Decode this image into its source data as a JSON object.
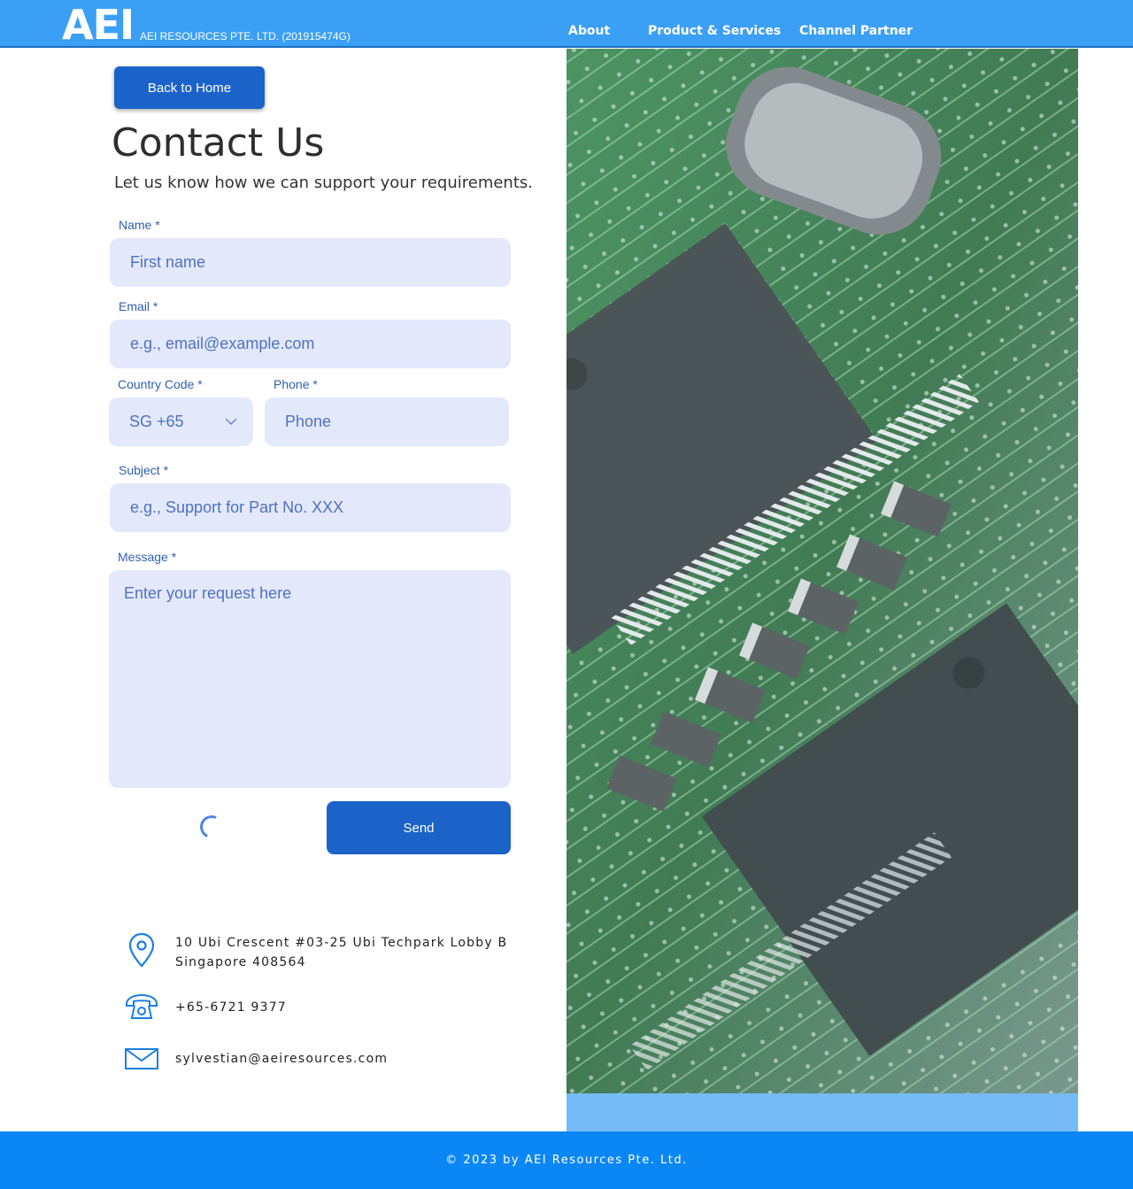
{
  "header": {
    "logo": "AEI",
    "company": "AEI RESOURCES PTE. LTD. (201915474G)",
    "nav": [
      {
        "label": "About"
      },
      {
        "label": "Product & Services"
      },
      {
        "label": "Channel Partner"
      }
    ],
    "background_color": "#3ba0f5"
  },
  "back_button": {
    "label": "Back to Home"
  },
  "title": "Contact Us",
  "subtitle": "Let us know how we can support your requirements.",
  "form": {
    "name": {
      "label": "Name *",
      "placeholder": "First name"
    },
    "email": {
      "label": "Email *",
      "placeholder": "e.g., email@example.com"
    },
    "country_code": {
      "label": "Country Code *",
      "value": "SG +65"
    },
    "phone": {
      "label": "Phone *",
      "placeholder": "Phone"
    },
    "subject": {
      "label": "Subject *",
      "placeholder": "e.g., Support for Part No. XXX"
    },
    "message": {
      "label": "Message *",
      "placeholder": "Enter your request here"
    },
    "send_label": "Send"
  },
  "contact": {
    "address_line1": "10 Ubi Crescent #03-25 Ubi Techpark Lobby B",
    "address_line2": "Singapore 408564",
    "phone": "+65-6721 9377",
    "email": "sylvestian@aeiresources.com",
    "icon_color": "#1a7fe0"
  },
  "footer": {
    "text": "© 2023 by AEI Resources Pte. Ltd.",
    "background_color": "#0b87f5"
  },
  "colors": {
    "button": "#1c63c9",
    "field_bg": "#e3e9fb",
    "label": "#2f5fb3"
  }
}
